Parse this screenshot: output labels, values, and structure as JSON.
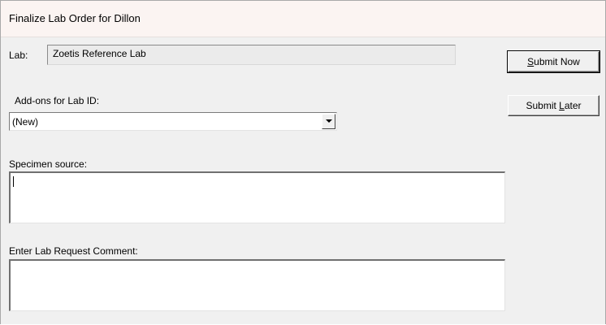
{
  "dialog": {
    "title": "Finalize Lab Order for Dillon"
  },
  "lab": {
    "label": "Lab:",
    "value": "Zoetis Reference Lab"
  },
  "addons": {
    "label": "Add-ons for Lab ID:",
    "selected": "(New)"
  },
  "specimen": {
    "label": "Specimen source:",
    "value": ""
  },
  "comment": {
    "label": "Enter Lab Request Comment:",
    "value": ""
  },
  "buttons": {
    "submit_now": {
      "mnemonic": "S",
      "rest": "ubmit Now"
    },
    "submit_later": {
      "prefix": "Submit ",
      "mnemonic": "L",
      "rest": "ater"
    }
  },
  "icons": {
    "dropdown": "chevron-down-icon"
  }
}
